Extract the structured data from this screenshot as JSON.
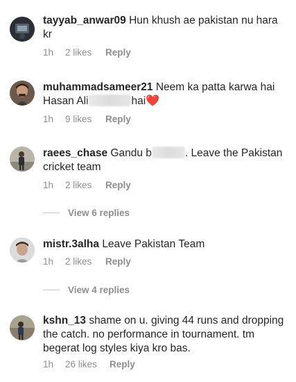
{
  "comments": [
    {
      "username": "tayyab_anwar09",
      "text": "Hun khush ae pakistan nu hara kr",
      "time": "1h",
      "likes": "2 likes",
      "reply": "Reply"
    },
    {
      "username": "muhammadsameer21",
      "text_before": "Neem ka patta karwa hai Hasan Ali",
      "text_after": "hai",
      "emoji": "❤️",
      "time": "1h",
      "likes": "9 likes",
      "reply": "Reply"
    },
    {
      "username": "raees_chase",
      "text_before": "Gandu b",
      "text_after": ". Leave the Pakistan cricket team",
      "time": "1h",
      "likes": "2 likes",
      "reply": "Reply",
      "view_replies": "View 6 replies"
    },
    {
      "username": "mistr.3alha",
      "text": "Leave Pakistan Team",
      "time": "1h",
      "likes": "2 likes",
      "reply": "Reply",
      "view_replies": "View 4 replies"
    },
    {
      "username": "kshn_13",
      "text": "shame on u. giving 44 runs and dropping the catch. no performance in tournament. tm begerat log styles kiya kro bas.",
      "time": "1h",
      "likes": "26 likes",
      "reply": "Reply"
    }
  ],
  "colors": {
    "text": "#262626",
    "meta": "#8e8e8e",
    "heart": "#e0245e"
  }
}
